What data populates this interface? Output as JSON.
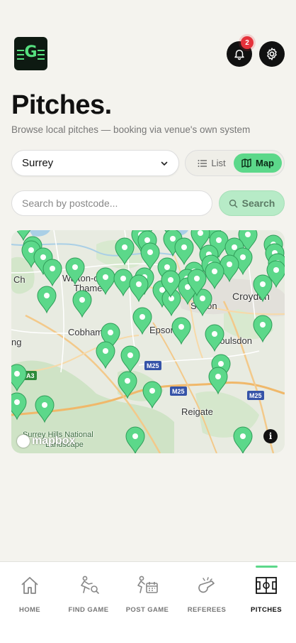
{
  "header": {
    "logo_letter": "G",
    "notification_count": "2"
  },
  "page": {
    "title": "Pitches.",
    "subtitle": "Browse local pitches — booking via venue's own system"
  },
  "filters": {
    "region": "Surrey",
    "view_options": [
      {
        "label": "List",
        "icon": "list-icon",
        "selected": false
      },
      {
        "label": "Map",
        "icon": "map-icon",
        "selected": true
      }
    ]
  },
  "search": {
    "placeholder": "Search by postcode...",
    "value": "",
    "button_label": "Search"
  },
  "map": {
    "places": [
      "Croydon",
      "Walton-on-Thames",
      "Sutton",
      "Cobham",
      "Epsom",
      "Coulsdon",
      "Reigate",
      "Surrey Hills National Landscape"
    ],
    "road_labels": {
      "m25": "M25",
      "a3": "A3"
    },
    "attribution": "mapbox",
    "pin_color": "#5cd88a",
    "pin_count": 60
  },
  "tabbar": {
    "tabs": [
      {
        "label": "HOME",
        "icon": "home-icon",
        "active": false
      },
      {
        "label": "FIND GAME",
        "icon": "find-game-icon",
        "active": false
      },
      {
        "label": "POST GAME",
        "icon": "post-game-icon",
        "active": false
      },
      {
        "label": "REFEREES",
        "icon": "whistle-icon",
        "active": false
      },
      {
        "label": "PITCHES",
        "icon": "pitch-icon",
        "active": true
      }
    ]
  },
  "colors": {
    "accent": "#5cd88a",
    "badge": "#e5323b",
    "background": "#f4f3ee"
  }
}
